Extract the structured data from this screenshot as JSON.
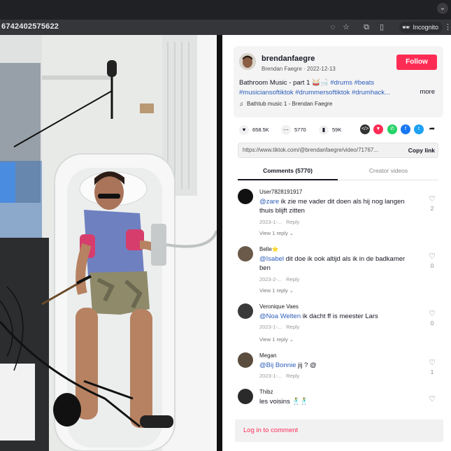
{
  "browser": {
    "url": "6742402575622",
    "incognito_label": "Incognito",
    "icons": [
      "eye-off-icon",
      "star-icon",
      "extension-icon",
      "sidepanel-icon",
      "incognito-icon",
      "menu-dots-icon"
    ]
  },
  "author": {
    "username": "brendanfaegre",
    "subline": "Brendan Faegre · 2022-12-13",
    "follow_label": "Follow",
    "desc_plain": "Bathroom Music - part 1 🥁🛁 ",
    "desc_tag1": "#drums",
    "desc_tag2": "#beats",
    "desc_line2": "#musiciansoftiktok #drummersoftiktok #drumhack...",
    "more_label": "more",
    "music_label": "Bathtub music 1 - Brendan Faegre"
  },
  "stats": {
    "likes": "658.5K",
    "comments": "5770",
    "saves": "59K"
  },
  "share": {
    "link_url": "https://www.tiktok.com/@brendanfaegre/video/71767...",
    "copy_label": "Copy link"
  },
  "tabs": {
    "comments": "Comments (5770)",
    "creator": "Creator videos"
  },
  "comments": [
    {
      "user": "User7828191917",
      "mention": "@zare",
      "text": " ik zie me vader dit doen als hij nog langen thuis blijft zitten",
      "date": "2023-1-...",
      "reply": "Reply",
      "view_replies": "View 1 reply ⌄",
      "likes": "2"
    },
    {
      "user": "Belle⭐",
      "mention": "@Isabel",
      "text": " dit doe ik ook altijd als ik in de badkamer ben",
      "date": "2023-2-...",
      "reply": "Reply",
      "view_replies": "View 1 reply ⌄",
      "likes": "0"
    },
    {
      "user": "Veronique Vaes",
      "mention": "@Noa Welten",
      "text": " ik dacht ff is meester Lars",
      "date": "2023-1-...",
      "reply": "Reply",
      "view_replies": "View 1 reply ⌄",
      "likes": "0"
    },
    {
      "user": "Megan",
      "mention": "@Bij Bonnie",
      "text": " jij ? @",
      "date": "2023-1-...",
      "reply": "Reply",
      "view_replies": "",
      "likes": "1"
    },
    {
      "user": "Thibz",
      "mention": "",
      "text": "les voisins 🕺🕺",
      "date": "",
      "reply": "",
      "view_replies": "",
      "likes": ""
    }
  ],
  "login_label": "Log in to comment",
  "colors": {
    "accent_red": "#fe2c55",
    "mention_blue": "#2b5db9",
    "chrome_dark": "#202124"
  }
}
